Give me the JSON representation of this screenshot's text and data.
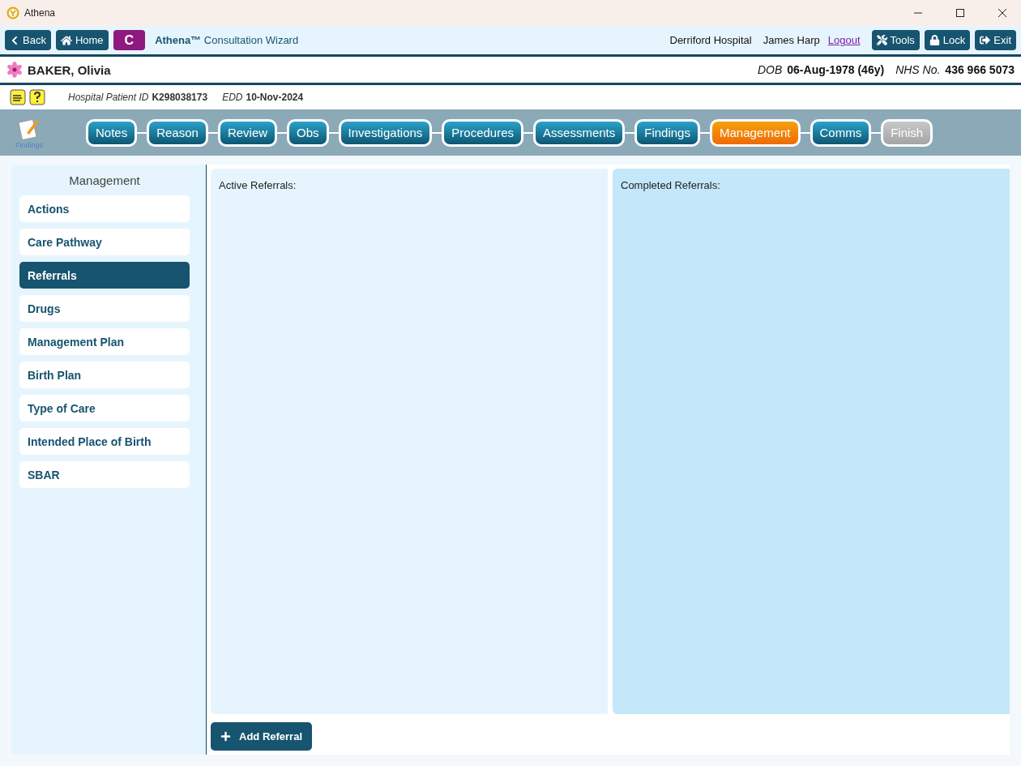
{
  "window": {
    "title": "Athena"
  },
  "toolbar": {
    "buttons": [
      {
        "kind": "back",
        "label": "Back"
      },
      {
        "kind": "home",
        "label": "Home"
      },
      {
        "kind": "letter",
        "label": "C"
      }
    ],
    "brand": "Athena™",
    "subtitle": "Consultation Wizard",
    "site": "Derriford Hospital",
    "user": "James Harp",
    "logout": "Logout",
    "actions": [
      {
        "kind": "tools",
        "label": "Tools"
      },
      {
        "kind": "lock",
        "label": "Lock"
      },
      {
        "kind": "exit",
        "label": "Exit"
      }
    ]
  },
  "patient": {
    "name": "BAKER, Olivia",
    "dob_label": "DOB",
    "dob": "06-Aug-1978 (46y)",
    "nhs_label": "NHS No.",
    "nhs": "436 966 5073",
    "id_label": "Hospital Patient ID",
    "id": "K298038173",
    "edd_label": "EDD",
    "edd": "10-Nov-2024"
  },
  "wizard": {
    "icon_label": "Findings",
    "steps": [
      {
        "label": "Notes",
        "selected": false,
        "disabled": false
      },
      {
        "label": "Reason",
        "selected": false,
        "disabled": false
      },
      {
        "label": "Review",
        "selected": false,
        "disabled": false
      },
      {
        "label": "Obs",
        "selected": false,
        "disabled": false
      },
      {
        "label": "Investigations",
        "selected": false,
        "disabled": false
      },
      {
        "label": "Procedures",
        "selected": false,
        "disabled": false
      },
      {
        "label": "Assessments",
        "selected": false,
        "disabled": false
      },
      {
        "label": "Findings",
        "selected": false,
        "disabled": false
      },
      {
        "label": "Management",
        "selected": true,
        "disabled": false
      },
      {
        "label": "Comms",
        "selected": false,
        "disabled": false
      },
      {
        "label": "Finish",
        "selected": false,
        "disabled": true
      }
    ]
  },
  "sidebar": {
    "title": "Management",
    "items": [
      {
        "label": "Actions",
        "selected": false
      },
      {
        "label": "Care Pathway",
        "selected": false
      },
      {
        "label": "Referrals",
        "selected": true
      },
      {
        "label": "Drugs",
        "selected": false
      },
      {
        "label": "Management Plan",
        "selected": false
      },
      {
        "label": "Birth Plan",
        "selected": false
      },
      {
        "label": "Type of Care",
        "selected": false
      },
      {
        "label": "Intended Place of Birth",
        "selected": false
      },
      {
        "label": "SBAR",
        "selected": false
      }
    ]
  },
  "panels": [
    {
      "kind": "active",
      "title": "Active Referrals:"
    },
    {
      "kind": "completed",
      "title": "Completed Referrals:"
    }
  ],
  "add_button": "Add Referral"
}
